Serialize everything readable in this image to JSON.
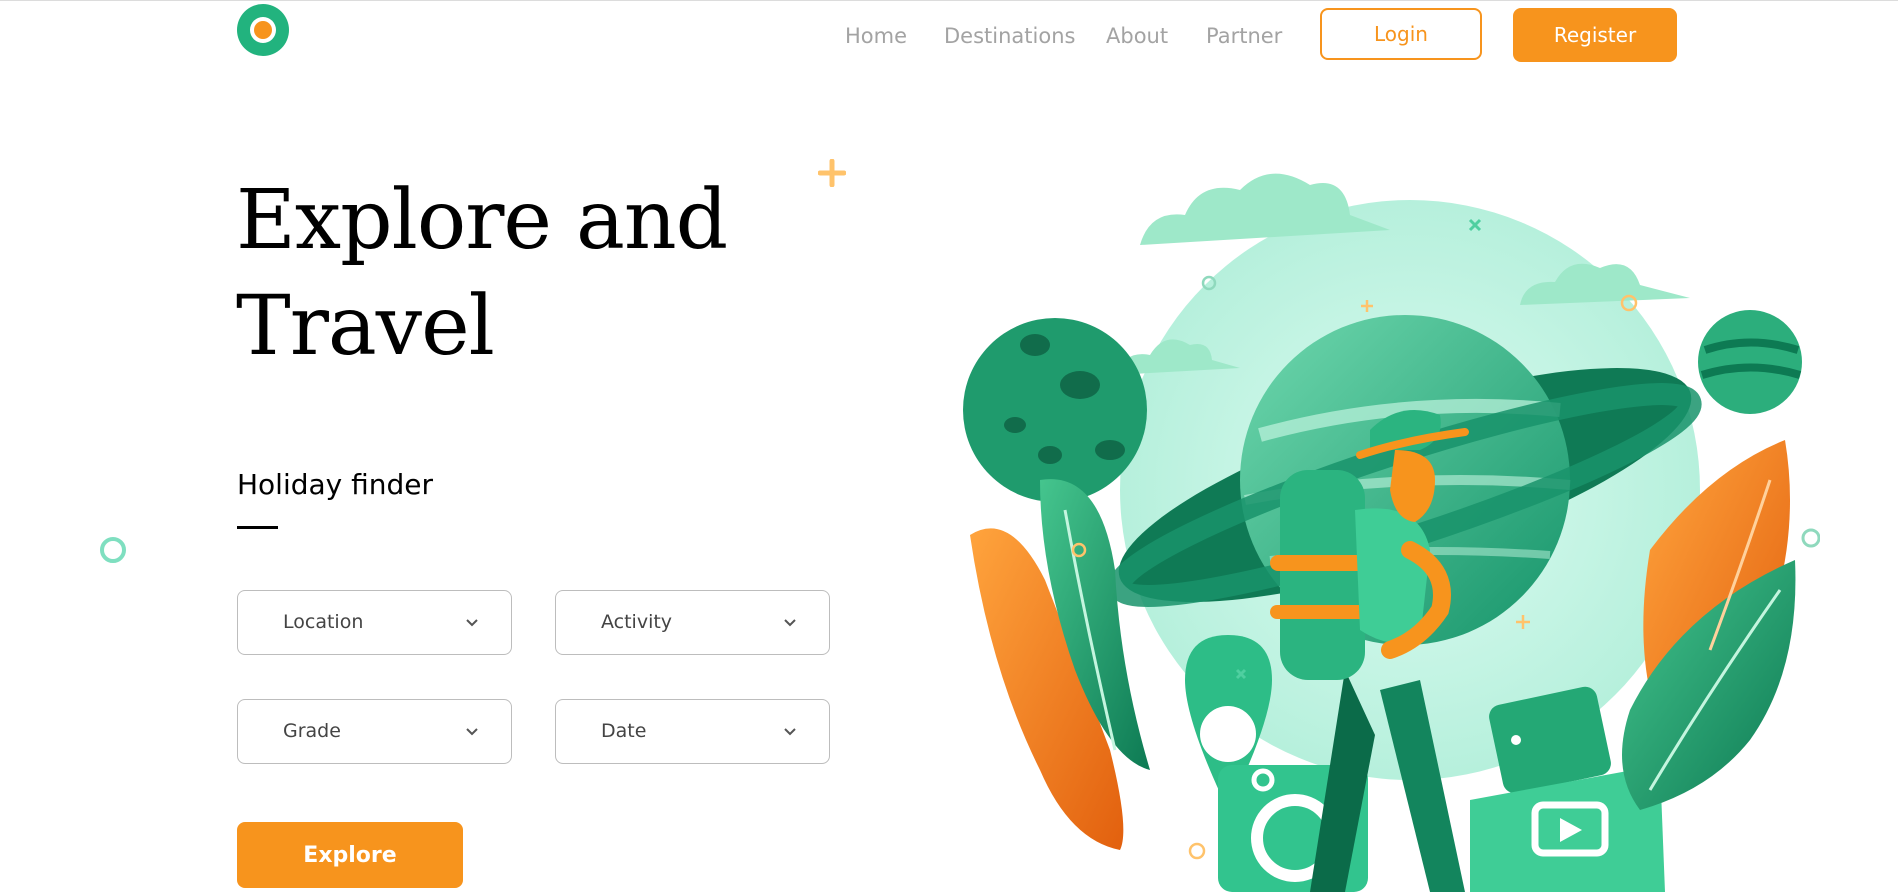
{
  "header": {
    "nav": [
      "Home",
      "Destinations",
      "About",
      "Partner"
    ],
    "login_label": "Login",
    "register_label": "Register"
  },
  "hero": {
    "title_line1": "Explore and",
    "title_line2": "Travel",
    "finder_title": "Holiday finder",
    "filters": [
      "Location",
      "Activity",
      "Grade",
      "Date"
    ],
    "explore_label": "Explore"
  },
  "colors": {
    "accent": "#f7941d",
    "brand_green": "#22b37e",
    "light_mint": "#c9f5e6"
  },
  "icons": {
    "logo": "circle-logo-icon",
    "dropdown": "chevron-down-icon"
  }
}
